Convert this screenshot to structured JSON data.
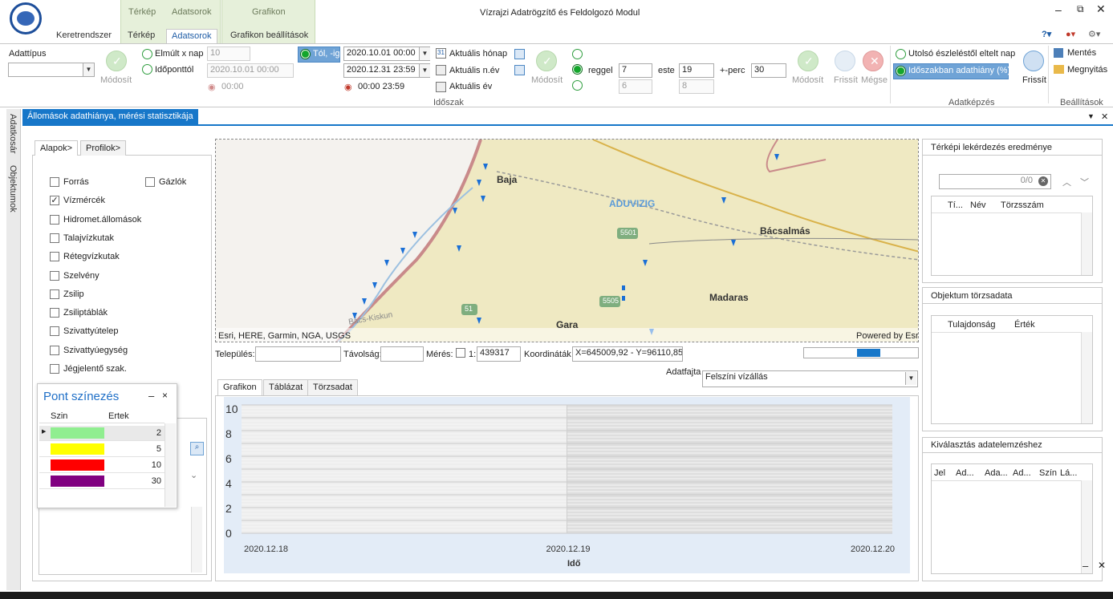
{
  "window": {
    "title": "Vízrajzi Adatrögzítő és Feldolgozó Modul",
    "ctx_groups": [
      "Térkép",
      "Adatsorok",
      "Grafikon"
    ],
    "tabs": [
      "Keretrendszer",
      "Térkép",
      "Adatsorok",
      "Grafikon beállítások"
    ],
    "active_tab": "Adatsorok"
  },
  "ribbon": {
    "adattipus_label": "Adattípus",
    "modosit_label": "Módosít",
    "elmult_label": "Elmúlt x nap",
    "elmult_value": "10",
    "idopont_label": "Időponttól",
    "idopont_value": "2020.10.01 00:00",
    "idopont_time": "00:00",
    "tol_ig_label": "Tól, -ig",
    "from_value": "2020.10.01 00:00",
    "to_value": "2020.12.31 23:59",
    "to_time": "00:00 23:59",
    "aktualis_honap": "Aktuális hónap",
    "aktualis_nev": "Aktuális n.év",
    "aktualis_ev": "Aktuális év",
    "idoszak_group": "Időszak",
    "reggel_label": "reggel",
    "reggel_value": "7",
    "reggel_value2": "6",
    "este_label": "este",
    "este_value": "19",
    "este_value2": "8",
    "perc_label": "+-perc",
    "perc_value": "30",
    "frissit_label": "Frissít",
    "megse_label": "Mégse",
    "utolso_label": "Utolsó észleléstől eltelt nap",
    "idoszak_adathiany": "Időszakban adathiány (%)",
    "frissit2_label": "Frissít",
    "adatkepzes_group": "Adatképzés",
    "mentes_label": "Mentés",
    "megnyitas_label": "Megnyitás",
    "beallitasok_group": "Beállítások",
    "calendar_day": "31"
  },
  "doc": {
    "tab_title": "Állomások adathiánya, mérési statisztikája",
    "side_adatkosar": "Adatkosár",
    "side_objektumok": "Objektumok"
  },
  "left": {
    "tabs": [
      "Alapok>",
      "Profilok>"
    ],
    "checks": [
      {
        "label": "Forrás",
        "checked": false
      },
      {
        "label": "Vízmércék",
        "checked": true
      },
      {
        "label": "Hidromet.állomások",
        "checked": false
      },
      {
        "label": "Talajvízkutak",
        "checked": false
      },
      {
        "label": "Rétegvízkutak",
        "checked": false
      },
      {
        "label": "Szelvény",
        "checked": false
      },
      {
        "label": "Zsilip",
        "checked": false
      },
      {
        "label": "Zsiliptáblák",
        "checked": false
      },
      {
        "label": "Szivattyútelep",
        "checked": false
      },
      {
        "label": "Szivattyúegység",
        "checked": false
      },
      {
        "label": "Jégjelentő szak.",
        "checked": false
      }
    ],
    "gazlok": "Gázlók"
  },
  "pont": {
    "title": "Pont színezés",
    "col_szin": "Szin",
    "col_ertek": "Ertek",
    "rows": [
      {
        "color": "#90ee90",
        "value": "2"
      },
      {
        "color": "#ffff00",
        "value": "5"
      },
      {
        "color": "#ff0000",
        "value": "10"
      },
      {
        "color": "#800080",
        "value": "30"
      }
    ]
  },
  "map": {
    "labels": {
      "baja": "Baja",
      "aduvizig": "ADUVIZIG",
      "bacsalmas": "Bácsalmás",
      "madaras": "Madaras",
      "gara": "Gara",
      "bacskiskun": "Bács-Kiskun"
    },
    "roads": [
      "5501",
      "5505",
      "51"
    ],
    "attribution": "Esri, HERE, Garmin, NGA, USGS",
    "powered": "Powered by Esri"
  },
  "mapbar": {
    "telepules_label": "Település:",
    "tavolsag_label": "Távolság:",
    "meres_label": "Mérés:",
    "scale_prefix": "1:",
    "scale_value": "439317",
    "koord_label": "Koordináták",
    "koord_value": "X=645009,92 - Y=96110,85"
  },
  "chartpanel": {
    "adatfajta_label": "Adatfajta",
    "adatfajta_value": "Felszíni vízállás",
    "tabs": [
      "Grafikon",
      "Táblázat",
      "Törzsadat"
    ]
  },
  "chart_data": {
    "type": "line",
    "x": [
      "2020.12.18",
      "2020.12.19",
      "2020.12.20"
    ],
    "series": [],
    "yticks": [
      "10",
      "8",
      "6",
      "4",
      "2",
      "0"
    ],
    "xlabel": "Idő",
    "ylim": [
      0,
      10
    ],
    "grid": true
  },
  "right": {
    "lek_title": "Térképi lekérdezés eredménye",
    "lek_count": "0/0",
    "lek_cols": [
      "Tí...",
      "Név",
      "Törzsszám"
    ],
    "obj_title": "Objektum törzsadata",
    "obj_cols": [
      "Tulajdonság",
      "Érték"
    ],
    "kiv_title": "Kiválasztás adatelemzéshez",
    "kiv_cols": [
      "Jel",
      "Ad...",
      "Ada...",
      "Ad...",
      "Szín",
      "Lá..."
    ]
  }
}
